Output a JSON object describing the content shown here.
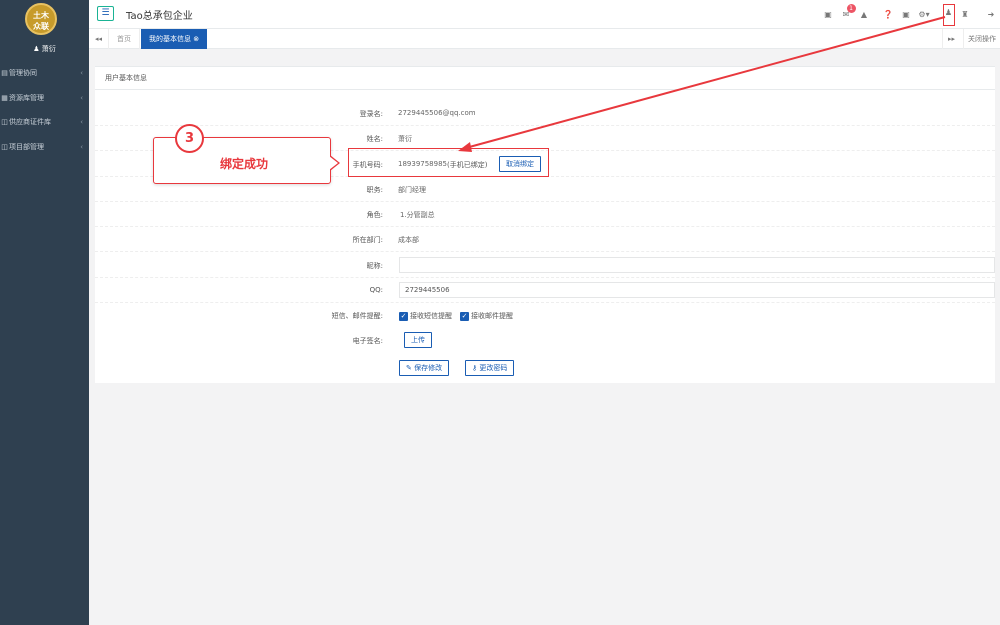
{
  "app": {
    "title": "Tao总承包企业",
    "logo_text_1": "土木",
    "logo_text_2": "众联",
    "user_name": "萧衍"
  },
  "sidebar": {
    "items": [
      {
        "label": "管理协同",
        "icon": "chart-icon"
      },
      {
        "label": "资源库管理",
        "icon": "grid-icon"
      },
      {
        "label": "供应商证件库",
        "icon": "folder-icon"
      },
      {
        "label": "项目部管理",
        "icon": "folder-icon"
      }
    ]
  },
  "topbar": {
    "notification_count": "1"
  },
  "tabs": {
    "home": "首页",
    "active": "我的基本信息",
    "close_ops": "关闭操作"
  },
  "panel": {
    "title": "用户基本信息",
    "fields": {
      "login_label": "登录名:",
      "login_value": "2729445506@qq.com",
      "name_label": "姓名:",
      "name_value": "萧衍",
      "phone_label": "手机号码:",
      "phone_value": "18939758985",
      "phone_status": "(手机已绑定)",
      "unbind_button": "取消绑定",
      "position_label": "职务:",
      "position_value": "部门经理",
      "role_label": "角色:",
      "role_value": "1.分管副总",
      "dept_label": "所在部门:",
      "dept_value": "成本部",
      "nickname_label": "昵称:",
      "nickname_value": "",
      "qq_label": "QQ:",
      "qq_value": "2729445506",
      "notify_label": "短信、邮件提醒:",
      "sms_check": "接收短信提醒",
      "email_check": "接收邮件提醒",
      "signature_label": "电子签名:",
      "upload_button": "上传",
      "save_button": "保存修改",
      "password_button": "更改密码"
    }
  },
  "annotation": {
    "step": "3",
    "text": "绑定成功"
  }
}
